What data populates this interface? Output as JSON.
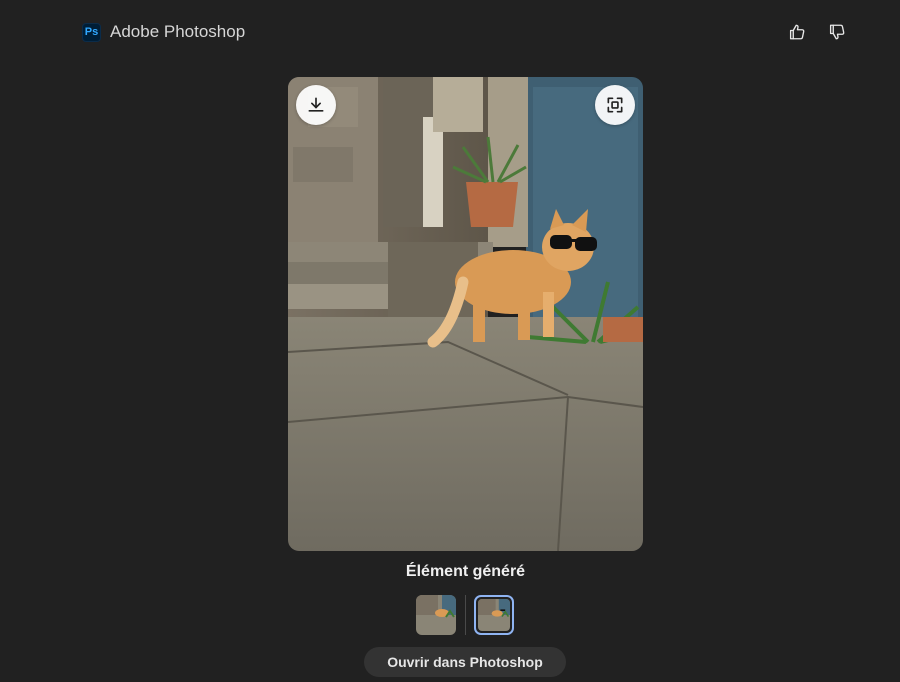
{
  "header": {
    "logo_text": "Ps",
    "app_name": "Adobe Photoshop"
  },
  "feedback": {
    "like_icon": "thumbs-up-icon",
    "dislike_icon": "thumbs-down-icon"
  },
  "image": {
    "subject": "orange cat wearing sunglasses on stone steps",
    "download_icon": "download-icon",
    "fullscreen_icon": "fullscreen-icon"
  },
  "caption": "Élément généré",
  "thumbnails": [
    {
      "icon": "image-thumbnail",
      "selected": false
    },
    {
      "icon": "image-thumbnail",
      "selected": true
    }
  ],
  "open_button": "Ouvrir dans Photoshop",
  "colors": {
    "background": "#212121",
    "accent_selected": "#8fb4f2",
    "ps_brand": "#31a8ff"
  }
}
